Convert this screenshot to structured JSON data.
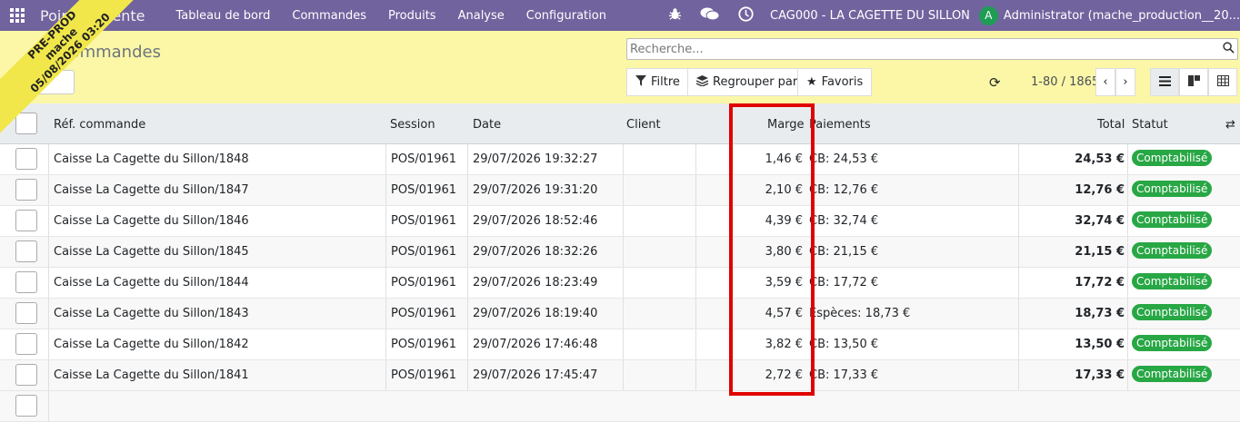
{
  "navbar": {
    "app_name": "Point de vente",
    "menu": [
      "Tableau de bord",
      "Commandes",
      "Produits",
      "Analyse",
      "Configuration"
    ],
    "company": "CAG000 - LA CAGETTE DU SILLON",
    "avatar_letter": "A",
    "user": "Administrator (mache_production__20..."
  },
  "ribbon": {
    "line1": "PRE-PROD",
    "line2": "mache",
    "line3": "05/08/2026 03:20"
  },
  "control": {
    "title": "Commandes",
    "search_placeholder": "Recherche...",
    "filter_label": "Filtre",
    "group_label": "Regrouper par",
    "fav_label": "Favoris",
    "pager": "1-80 / 1865"
  },
  "table": {
    "headers": {
      "ref": "Réf. commande",
      "session": "Session",
      "date": "Date",
      "client": "Client",
      "marge": "Marge",
      "paiements": "Paiements",
      "total": "Total",
      "statut": "Statut"
    },
    "rows": [
      {
        "ref": "Caisse La Cagette du Sillon/1848",
        "session": "POS/01961",
        "date": "29/07/2026 19:32:27",
        "marge": "1,46 €",
        "paiements": "CB: 24,53 €",
        "total": "24,53 €",
        "statut": "Comptabilisé"
      },
      {
        "ref": "Caisse La Cagette du Sillon/1847",
        "session": "POS/01961",
        "date": "29/07/2026 19:31:20",
        "marge": "2,10 €",
        "paiements": "CB: 12,76 €",
        "total": "12,76 €",
        "statut": "Comptabilisé"
      },
      {
        "ref": "Caisse La Cagette du Sillon/1846",
        "session": "POS/01961",
        "date": "29/07/2026 18:52:46",
        "marge": "4,39 €",
        "paiements": "CB: 32,74 €",
        "total": "32,74 €",
        "statut": "Comptabilisé"
      },
      {
        "ref": "Caisse La Cagette du Sillon/1845",
        "session": "POS/01961",
        "date": "29/07/2026 18:32:26",
        "marge": "3,80 €",
        "paiements": "CB: 21,15 €",
        "total": "21,15 €",
        "statut": "Comptabilisé"
      },
      {
        "ref": "Caisse La Cagette du Sillon/1844",
        "session": "POS/01961",
        "date": "29/07/2026 18:23:49",
        "marge": "3,59 €",
        "paiements": "CB: 17,72 €",
        "total": "17,72 €",
        "statut": "Comptabilisé"
      },
      {
        "ref": "Caisse La Cagette du Sillon/1843",
        "session": "POS/01961",
        "date": "29/07/2026 18:19:40",
        "marge": "4,57 €",
        "paiements": "Espèces: 18,73 €",
        "total": "18,73 €",
        "statut": "Comptabilisé"
      },
      {
        "ref": "Caisse La Cagette du Sillon/1842",
        "session": "POS/01961",
        "date": "29/07/2026 17:46:48",
        "marge": "3,82 €",
        "paiements": "CB: 13,50 €",
        "total": "13,50 €",
        "statut": "Comptabilisé"
      },
      {
        "ref": "Caisse La Cagette du Sillon/1841",
        "session": "POS/01961",
        "date": "29/07/2026 17:45:47",
        "marge": "2,72 €",
        "paiements": "CB: 17,33 €",
        "total": "17,33 €",
        "statut": "Comptabilisé"
      }
    ]
  },
  "colors": {
    "navbar": "#71639e",
    "control_bg": "#fbf7a7",
    "badge": "#28a745",
    "highlight": "#e00000"
  }
}
